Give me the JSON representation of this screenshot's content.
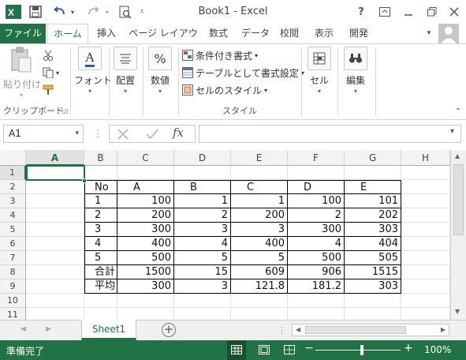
{
  "window": {
    "title": "Book1 - Excel",
    "help": "?"
  },
  "tabs": [
    "ファイル",
    "ホーム",
    "挿入",
    "ページ レイアウト",
    "数式",
    "データ",
    "校閲",
    "表示",
    "開発"
  ],
  "ribbon": {
    "paste_label": "貼り付け",
    "clipboard_label": "クリップボード",
    "font_label": "フォント",
    "alignment_label": "配置",
    "number_label": "数値",
    "number_icon_text": "%",
    "conditional_format": "条件付き書式",
    "format_as_table": "テーブルとして書式設定",
    "cell_styles": "セルのスタイル",
    "styles_label": "スタイル",
    "cells_label": "セル",
    "editing_label": "編集"
  },
  "formula_bar": {
    "name_box": "A1",
    "fx": "fx",
    "formula": ""
  },
  "columns": [
    "A",
    "B",
    "C",
    "D",
    "E",
    "F",
    "G",
    "H"
  ],
  "rows": [
    "1",
    "2",
    "3",
    "4",
    "5",
    "6",
    "7",
    "8",
    "9",
    "10",
    "11"
  ],
  "table": {
    "header": [
      "No",
      "A",
      "B",
      "C",
      "D",
      "E"
    ],
    "rows": [
      [
        "1",
        "100",
        "1",
        "1",
        "100",
        "101"
      ],
      [
        "2",
        "200",
        "2",
        "200",
        "2",
        "202"
      ],
      [
        "3",
        "300",
        "3",
        "3",
        "300",
        "303"
      ],
      [
        "4",
        "400",
        "4",
        "400",
        "4",
        "404"
      ],
      [
        "5",
        "500",
        "5",
        "5",
        "500",
        "505"
      ],
      [
        "合計",
        "1500",
        "15",
        "609",
        "906",
        "1515"
      ],
      [
        "平均",
        "300",
        "3",
        "121.8",
        "181.2",
        "303"
      ]
    ]
  },
  "sheets": [
    "Sheet1"
  ],
  "status": {
    "ready": "準備完了",
    "zoom": "100%"
  },
  "colors": {
    "accent": "#217346"
  }
}
